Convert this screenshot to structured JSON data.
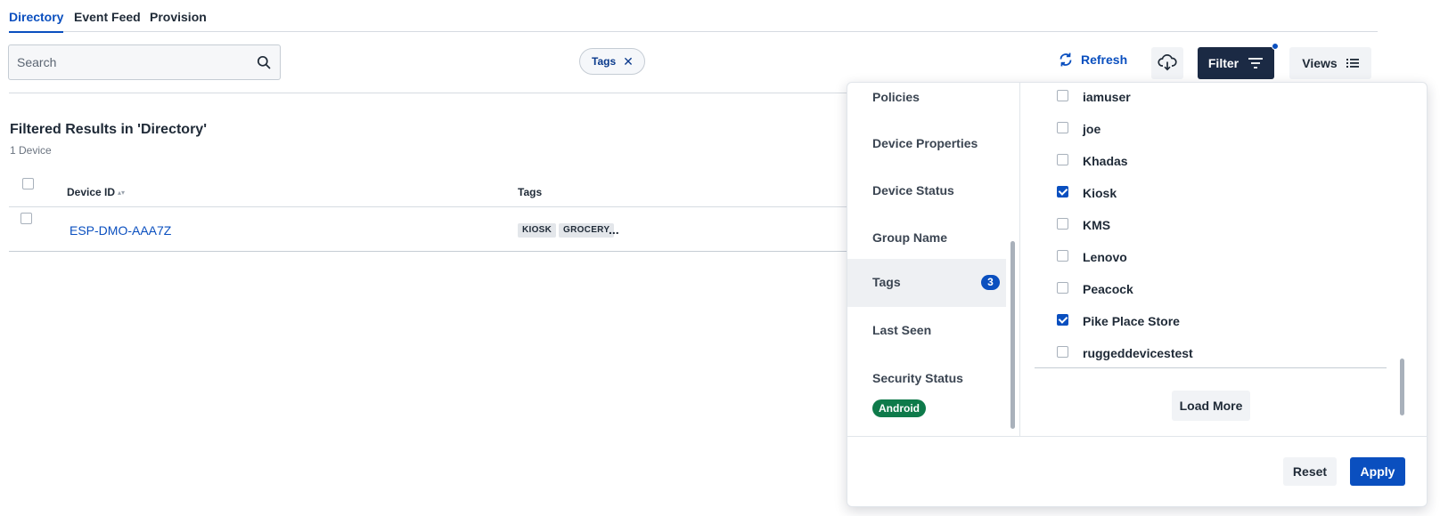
{
  "tabs": [
    {
      "label": "Directory",
      "active": true
    },
    {
      "label": "Event Feed",
      "active": false
    },
    {
      "label": "Provision",
      "active": false
    }
  ],
  "search": {
    "placeholder": "Search",
    "value": "",
    "icon": "search-icon"
  },
  "active_filter_chip": {
    "label": "Tags",
    "remove_icon": "close-icon"
  },
  "toolbar": {
    "refresh_label": "Refresh",
    "refresh_icon": "refresh-icon",
    "download_icon": "cloud-download-icon",
    "filter_label": "Filter",
    "filter_icon": "filter-lines-icon",
    "views_label": "Views",
    "views_icon": "list-icon"
  },
  "results": {
    "title": "Filtered Results in 'Directory'",
    "count": "1 Device",
    "columns": [
      "Device ID",
      "Tags"
    ],
    "rows": [
      {
        "device_id": "ESP-DMO-AAA7Z",
        "tags": [
          "KIOSK",
          "GROCERY"
        ],
        "tags_more": "..."
      }
    ]
  },
  "filter_panel": {
    "categories": [
      {
        "label": "Policies"
      },
      {
        "label": "Device Properties"
      },
      {
        "label": "Device Status"
      },
      {
        "label": "Group Name"
      },
      {
        "label": "Tags",
        "badge": "3",
        "active": true
      },
      {
        "label": "Last Seen"
      },
      {
        "label": "Security Status",
        "badge_text": "Android"
      }
    ],
    "options": [
      {
        "label": "iamuser",
        "checked": false
      },
      {
        "label": "joe",
        "checked": false
      },
      {
        "label": "Khadas",
        "checked": false
      },
      {
        "label": "Kiosk",
        "checked": true
      },
      {
        "label": "KMS",
        "checked": false
      },
      {
        "label": "Lenovo",
        "checked": false
      },
      {
        "label": "Peacock",
        "checked": false
      },
      {
        "label": "Pike Place Store",
        "checked": true
      },
      {
        "label": "ruggeddevicestest",
        "checked": false
      }
    ],
    "load_more_label": "Load More",
    "reset_label": "Reset",
    "apply_label": "Apply"
  },
  "colors": {
    "accent": "#0a4fbf",
    "filter_button": "#1b2a44",
    "android_badge": "#0e7a4a"
  }
}
